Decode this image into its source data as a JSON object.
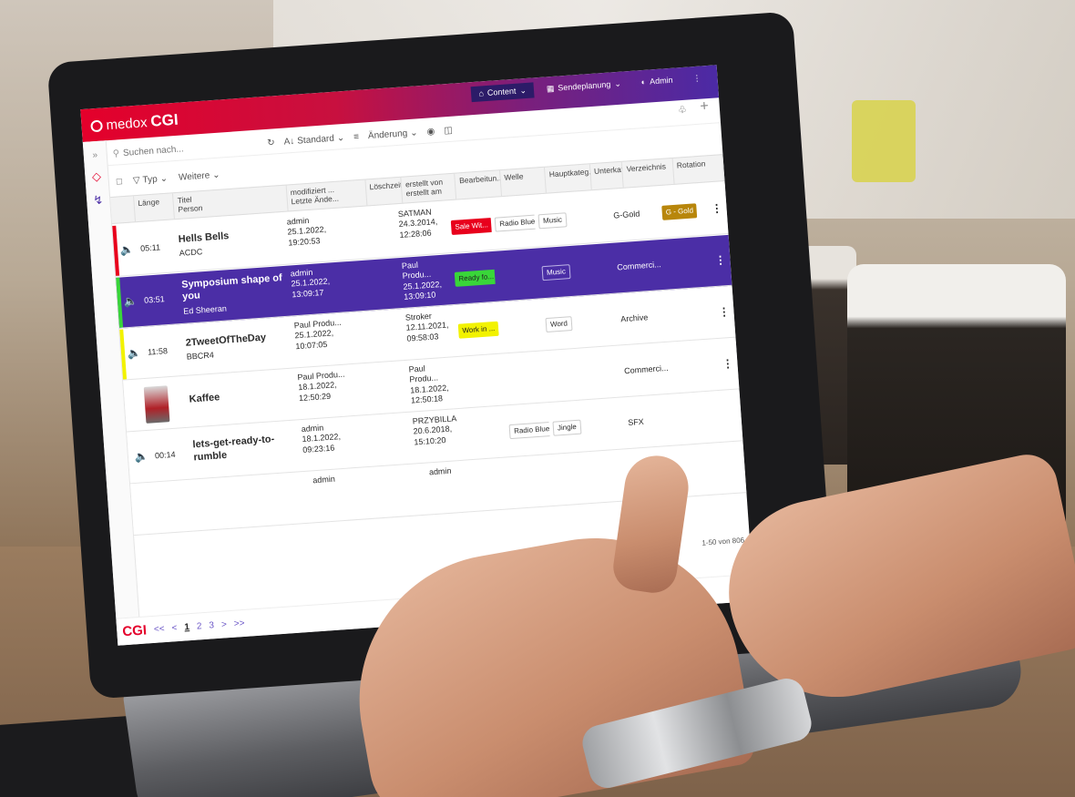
{
  "app": {
    "logo_brand": "medox",
    "logo_name": "CGI",
    "footer_logo": "CGI"
  },
  "top_nav": {
    "content": "Content",
    "sendeplanung": "Sendeplanung",
    "admin": "Admin"
  },
  "toolbar": {
    "search_placeholder": "Suchen nach...",
    "sort_label": "Standard",
    "sort_prefix": "A↓",
    "change_label": "Änderung"
  },
  "filters": {
    "type_label": "Typ",
    "more_label": "Weitere"
  },
  "columns": [
    {
      "line1": "Länge",
      "line2": ""
    },
    {
      "line1": "Titel",
      "line2": "Person"
    },
    {
      "line1": "modifiziert ...",
      "line2": "Letzte Ände..."
    },
    {
      "line1": "Löschzeitp...",
      "line2": ""
    },
    {
      "line1": "erstellt von",
      "line2": "erstellt am"
    },
    {
      "line1": "Bearbeitun...",
      "line2": ""
    },
    {
      "line1": "Welle",
      "line2": ""
    },
    {
      "line1": "Hauptkateg...",
      "line2": ""
    },
    {
      "line1": "Unterkateg...",
      "line2": ""
    },
    {
      "line1": "Verzeichnis",
      "line2": ""
    },
    {
      "line1": "Rotation",
      "line2": ""
    }
  ],
  "rows": [
    {
      "length": "05:11",
      "title": "Hells Bells",
      "person": "ACDC",
      "mod_by": "admin",
      "mod_date": "25.1.2022,",
      "mod_time": "19:20:53",
      "created_by": "SATMAN",
      "created_date": "24.3.2014,",
      "created_time": "12:28:06",
      "status": "Sale Wit...",
      "status_color": "#e8001c",
      "welle": "Radio Blue",
      "haupt": "Music",
      "verz": "G-Gold",
      "rotation": "G - Gold",
      "bar_color": "#e8001c"
    },
    {
      "length": "03:51",
      "title": "Symposium shape of you",
      "person": "Ed Sheeran",
      "mod_by": "admin",
      "mod_date": "25.1.2022,",
      "mod_time": "13:09:17",
      "created_by": "Paul Produ...",
      "created_date": "25.1.2022,",
      "created_time": "13:09:10",
      "status": "Ready fo...",
      "status_color": "#39d639",
      "welle": "",
      "haupt": "Music",
      "verz": "Commerci...",
      "rotation": "",
      "bar_color": "#39d639"
    },
    {
      "length": "11:58",
      "title": "2TweetOfTheDay",
      "person": "BBCR4",
      "mod_by": "Paul Produ...",
      "mod_date": "25.1.2022,",
      "mod_time": "10:07:05",
      "created_by": "Stroker",
      "created_date": "12.11.2021,",
      "created_time": "09:58:03",
      "status": "Work in ...",
      "status_color": "#f2f200",
      "welle": "",
      "haupt": "Word",
      "verz": "Archive",
      "rotation": "",
      "bar_color": "#f2f200"
    },
    {
      "length": "",
      "title": "Kaffee",
      "person": "",
      "mod_by": "Paul Produ...",
      "mod_date": "18.1.2022,",
      "mod_time": "12:50:29",
      "created_by": "Paul Produ...",
      "created_date": "18.1.2022,",
      "created_time": "12:50:18",
      "status": "",
      "status_color": "",
      "welle": "",
      "haupt": "",
      "verz": "Commerci...",
      "rotation": "",
      "bar_color": ""
    },
    {
      "length": "00:14",
      "title": "lets-get-ready-to-rumble",
      "person": "",
      "mod_by": "admin",
      "mod_date": "18.1.2022,",
      "mod_time": "09:23:16",
      "created_by": "PRZYBILLA",
      "created_date": "20.6.2018,",
      "created_time": "15:10:20",
      "status": "",
      "status_color": "",
      "welle": "Radio Blue",
      "haupt": "Jingle",
      "verz": "SFX",
      "rotation": "",
      "bar_color": ""
    },
    {
      "length": "",
      "title": "",
      "person": "",
      "mod_by": "admin",
      "mod_date": "",
      "mod_time": "",
      "created_by": "admin",
      "created_date": "",
      "created_time": "",
      "status": "",
      "status_color": "",
      "welle": "",
      "haupt": "",
      "verz": "",
      "rotation": "",
      "bar_color": ""
    }
  ],
  "pager": {
    "first": "<<",
    "prev": "<",
    "p1": "1",
    "p2": "2",
    "p3": "3",
    "next": ">",
    "last": ">>",
    "count": "1-50 von 806"
  },
  "colors": {
    "accent": "#4b2ea6",
    "brand_red": "#e4002b",
    "rotation_gold": "#b8860b"
  }
}
